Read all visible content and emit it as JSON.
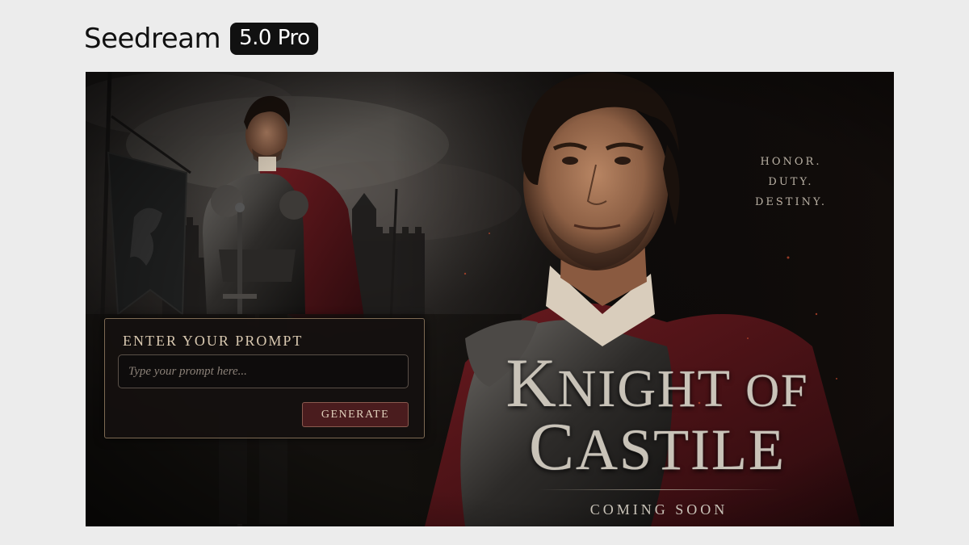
{
  "header": {
    "brand": "Seedream",
    "version": "5.0 Pro"
  },
  "poster": {
    "tagline": [
      "HONOR.",
      "DUTY.",
      "DESTINY."
    ],
    "title": {
      "line1_initial": "K",
      "line1_rest": "NIGHT",
      "line1_of": "OF",
      "line2_initial": "C",
      "line2_rest": "ASTILE"
    },
    "coming_soon": "COMING SOON"
  },
  "prompt": {
    "heading": "ENTER YOUR PROMPT",
    "placeholder": "Type your prompt here...",
    "value": "",
    "generate_label": "GENERATE"
  },
  "colors": {
    "accent_burgundy": "#4a1c1e",
    "panel_border": "#7d6a53",
    "title_silver": "#c9c3b8",
    "page_background": "#ececec"
  },
  "icons": {
    "banner": "heraldic-lion-banner",
    "castle": "castle-silhouette"
  }
}
